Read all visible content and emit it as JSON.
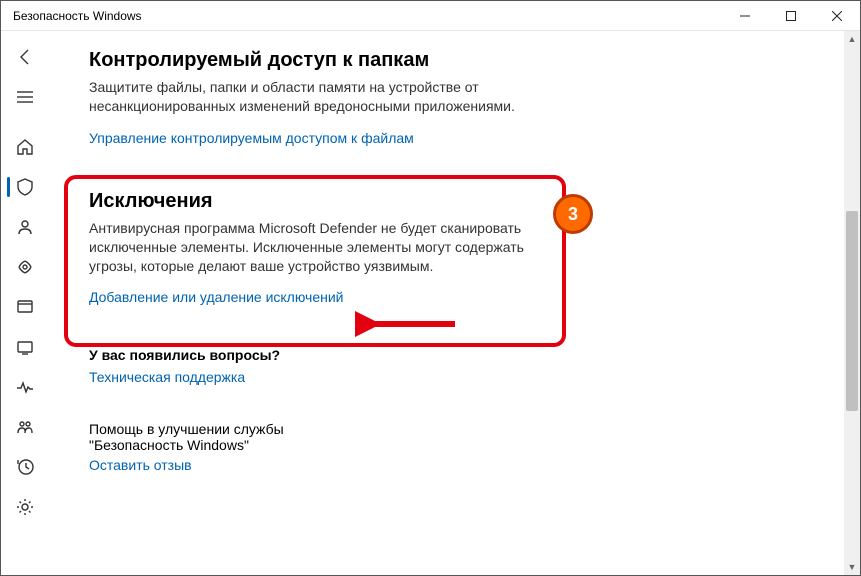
{
  "titlebar": {
    "title": "Безопасность Windows"
  },
  "sidebar": {
    "items": [
      {
        "name": "back-icon"
      },
      {
        "name": "menu-icon"
      },
      {
        "name": "home-icon"
      },
      {
        "name": "shield-icon",
        "active": true
      },
      {
        "name": "account-icon"
      },
      {
        "name": "firewall-icon"
      },
      {
        "name": "app-browser-icon"
      },
      {
        "name": "device-security-icon"
      },
      {
        "name": "performance-icon"
      },
      {
        "name": "family-icon"
      },
      {
        "name": "history-icon"
      },
      {
        "name": "settings-icon"
      }
    ]
  },
  "content": {
    "folderaccess": {
      "title": "Контролируемый доступ к папкам",
      "body": "Защитите файлы, папки и области памяти на устройстве от несанкционированных изменений вредоносными приложениями.",
      "link": "Управление контролируемым доступом к файлам"
    },
    "exclusions": {
      "title": "Исключения",
      "body": "Антивирусная программа Microsoft Defender не будет сканировать исключенные элементы. Исключенные элементы могут содержать угрозы, которые делают ваше устройство уязвимым.",
      "link": "Добавление или удаление исключений"
    },
    "questions": {
      "title": "У вас появились вопросы?",
      "link": "Техническая поддержка"
    },
    "feedback": {
      "title": "Помощь в улучшении службы \"Безопасность Windows\"",
      "link": "Оставить отзыв"
    }
  },
  "annotation": {
    "step": "3"
  }
}
